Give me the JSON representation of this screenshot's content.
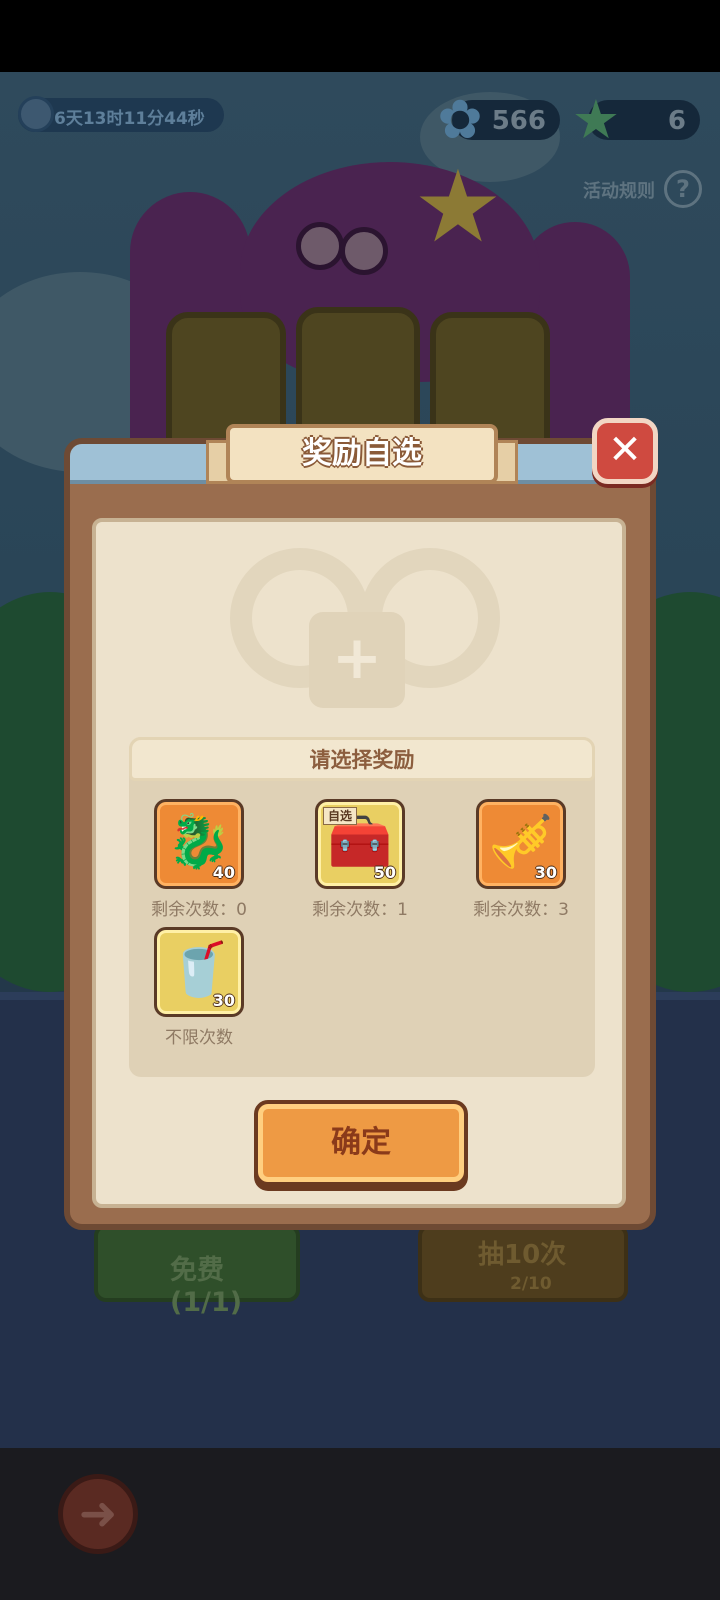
{
  "event": {
    "timer": "6天13时11分44秒",
    "currency_a": {
      "value": "566",
      "icon": "blue-flower-plus-icon"
    },
    "currency_b": {
      "value": "6",
      "icon": "green-starfish-icon"
    },
    "rules_label": "活动规则",
    "rules_icon": "?",
    "background_buttons": {
      "free_label": "免费(1/1)",
      "draw_ten_label": "抽10次",
      "draw_ten_cost": "2/10"
    },
    "back_icon": "back-arrow-icon"
  },
  "dialog": {
    "title": "奖励自选",
    "close_icon": "✕",
    "add_icon": "+",
    "panel_title": "请选择奖励",
    "rewards": [
      {
        "name": "dragon-icon",
        "count": "40",
        "caption": "剩余次数：0",
        "tag": "",
        "style": "orange"
      },
      {
        "name": "chest-icon",
        "count": "50",
        "caption": "剩余次数：1",
        "tag": "自选",
        "style": "yellow"
      },
      {
        "name": "golden-horn-icon",
        "count": "30",
        "caption": "剩余次数：3",
        "tag": "",
        "style": "orange"
      },
      {
        "name": "drink-icon",
        "count": "30",
        "caption": "不限次数",
        "tag": "",
        "style": "yellow"
      }
    ],
    "confirm_label": "确定"
  },
  "colors": {
    "dialog_frame": "#9a6d4e",
    "dialog_inner": "#ede2cc",
    "confirm_button": "#ee9a44",
    "close_button": "#cf4a40",
    "reward_orange": "#ee8a35",
    "reward_yellow": "#e9cf62"
  }
}
